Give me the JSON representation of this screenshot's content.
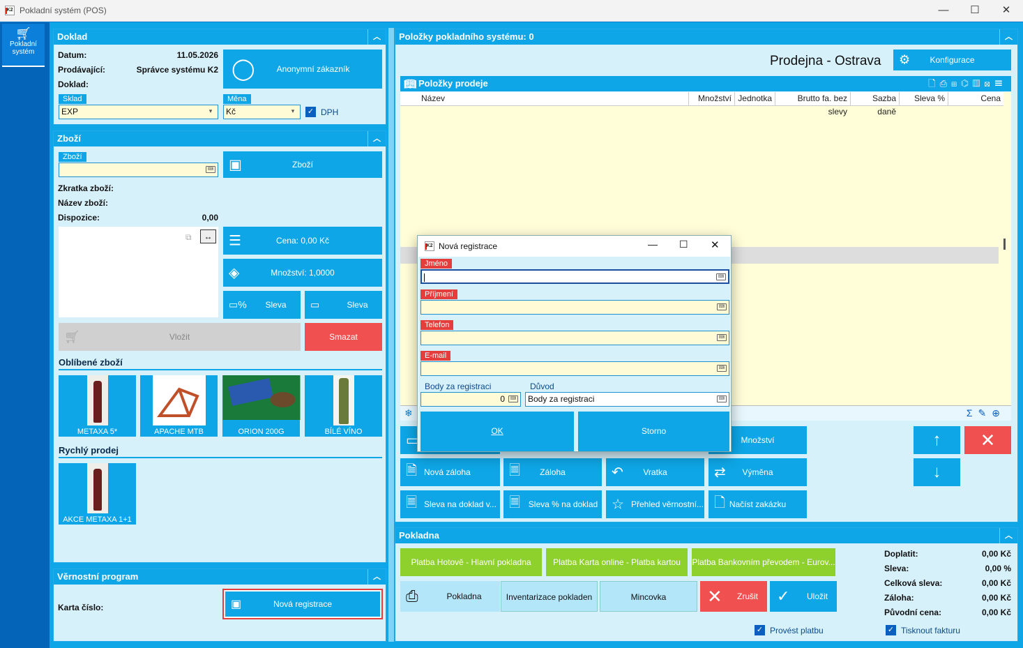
{
  "window": {
    "title": "Pokladní systém (POS)",
    "logo": "K2",
    "min": "—",
    "max": "☐",
    "close": "✕"
  },
  "leftbar": {
    "item_label": "Pokladní systém",
    "icon": "cart-icon"
  },
  "doklad": {
    "title": "Doklad",
    "datum_label": "Datum:",
    "datum_value": "11.05.2026",
    "prodavajici_label": "Prodávající:",
    "prodavajici_value": "Správce systému K2",
    "doklad_label": "Doklad:",
    "sklad_tag": "Sklad",
    "sklad_value": "EXP",
    "mena_tag": "Měna",
    "mena_value": "Kč",
    "dph_label": "DPH",
    "customer_button": "Anonymní zákazník"
  },
  "zbozi": {
    "title": "Zboží",
    "zbozi_tag": "Zboží",
    "zbozi_button": "Zboží",
    "zkratka_label": "Zkratka zboží:",
    "nazev_label": "Název zboží:",
    "dispozice_label": "Dispozice:",
    "dispozice_value": "0,00",
    "cena_button": "Cena: 0,00 Kč",
    "mnozstvi_button": "Množství: 1,0000",
    "sleva1": "Sleva",
    "sleva2": "Sleva",
    "vlozit": "Vložit",
    "smazat": "Smazat",
    "oblibene_title": "Oblíbené zboží",
    "oblibene": [
      "METAXA 5*",
      "APACHE MTB",
      "ORION 200G",
      "BÍLÉ VÍNO"
    ],
    "rychly_title": "Rychlý prodej",
    "rychly": [
      "AKCE METAXA 1+1"
    ]
  },
  "vernost": {
    "title": "Věrnostní program",
    "karta_label": "Karta číslo:",
    "nova_registrace": "Nová registrace"
  },
  "polozky": {
    "title": "Položky pokladního systému: 0",
    "store": "Prodejna - Ostrava",
    "konfigurace": "Konfigurace",
    "grid_title": "Položky prodeje",
    "columns": [
      "Název",
      "Množství",
      "Jednotka",
      "Brutto fa. bez slevy",
      "Sazba daně",
      "Sleva %",
      "Cena"
    ]
  },
  "actions": {
    "mnozstvi": "Množství",
    "nova_zaloha": "Nová záloha",
    "zaloha": "Záloha",
    "vratka": "Vratka",
    "vymena": "Výměna",
    "sleva_doklad": "Sleva na doklad v...",
    "sleva_pct": "Sleva % na doklad",
    "prehled": "Přehled věrnostní...",
    "nacist": "Načíst zakázku"
  },
  "pokladna": {
    "title": "Pokladna",
    "platba1": "Platba Hotově - Hlavní pokladna",
    "platba2": "Platba Karta online - Platba kartou",
    "platba3": "Platba Bankovním převodem - Eurov...",
    "pokladna_btn": "Pokladna",
    "inventarizace": "Inventarizace pokladen",
    "mincovka": "Mincovka",
    "zrusit": "Zrušit",
    "ulozit": "Uložit",
    "provest": "Provést platbu",
    "tisknout": "Tisknout fakturu",
    "summary": [
      {
        "k": "Doplatit:",
        "v": "0,00 Kč"
      },
      {
        "k": "Sleva:",
        "v": "0,00 %"
      },
      {
        "k": "Celková sleva:",
        "v": "0,00 Kč"
      },
      {
        "k": "Záloha:",
        "v": "0,00 Kč"
      },
      {
        "k": "Původní cena:",
        "v": "0,00 Kč"
      }
    ]
  },
  "dialog": {
    "title": "Nová registrace",
    "jmeno": "Jméno",
    "prijmeni": "Příjmení",
    "telefon": "Telefon",
    "email": "E-mail",
    "body_label": "Body za registraci",
    "body_value": "0",
    "duvod_label": "Důvod",
    "duvod_value": "Body za registraci",
    "ok": "OK",
    "storno": "Storno"
  },
  "colors": {
    "accent": "#0ea6e6",
    "panel": "#d7f1fb",
    "green": "#8ed02c",
    "red": "#f05050",
    "required": "#e53c3c"
  }
}
